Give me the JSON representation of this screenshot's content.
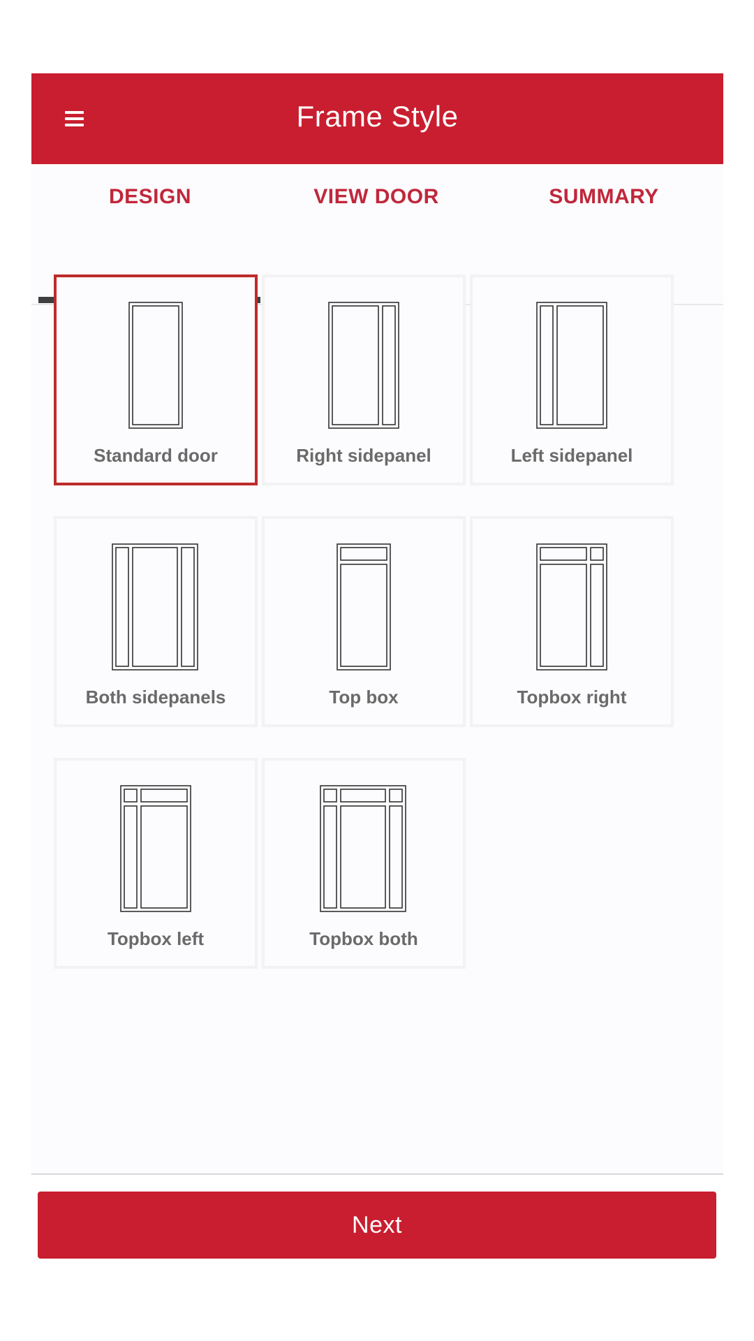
{
  "header": {
    "title": "Frame Style",
    "menu_icon": "hamburger-menu-icon"
  },
  "tabs": [
    {
      "label": "DESIGN",
      "active": true
    },
    {
      "label": "VIEW DOOR",
      "active": false
    },
    {
      "label": "SUMMARY",
      "active": false
    }
  ],
  "frame_styles": [
    {
      "label": "Standard door",
      "icon": "standard-door-icon",
      "selected": true
    },
    {
      "label": "Right sidepanel",
      "icon": "right-sidepanel-icon",
      "selected": false
    },
    {
      "label": "Left sidepanel",
      "icon": "left-sidepanel-icon",
      "selected": false
    },
    {
      "label": "Both sidepanels",
      "icon": "both-sidepanels-icon",
      "selected": false
    },
    {
      "label": "Top box",
      "icon": "top-box-icon",
      "selected": false
    },
    {
      "label": "Topbox right",
      "icon": "topbox-right-icon",
      "selected": false
    },
    {
      "label": "Topbox left",
      "icon": "topbox-left-icon",
      "selected": false
    },
    {
      "label": "Topbox both",
      "icon": "topbox-both-icon",
      "selected": false
    }
  ],
  "footer": {
    "next_label": "Next"
  },
  "colors": {
    "brand_red": "#c81e2f",
    "selected_border": "#be2b2b",
    "tab_text": "#c0273b",
    "tab_underline": "#3f3f3f",
    "label_text": "#6a6a6a"
  }
}
